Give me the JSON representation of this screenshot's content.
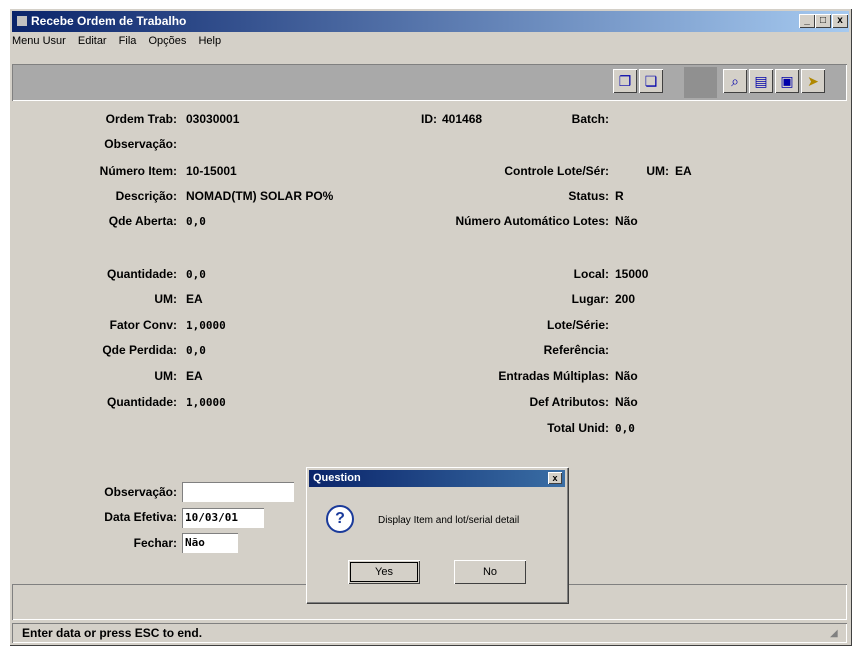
{
  "window": {
    "title": "Recebe Ordem de Trabalho"
  },
  "titlebar_buttons": {
    "minimize": "_",
    "maximize": "□",
    "close": "x"
  },
  "menu": [
    "Menu Usur",
    "Editar",
    "Fila",
    "Opções",
    "Help"
  ],
  "toolbar": {
    "icons": [
      "copy-icon",
      "paste-icon",
      "find-icon",
      "next-icon",
      "export-icon",
      "exit-icon"
    ]
  },
  "form": {
    "ordem_trab_label": "Ordem Trab:",
    "ordem_trab_value": "03030001",
    "id_label": "ID:",
    "id_value": "401468",
    "batch_label": "Batch:",
    "observacao_label": "Observação:",
    "numero_item_label": "Número Item:",
    "numero_item_value": "10-15001",
    "controle_lote_label": "Controle Lote/Sér:",
    "um_top_label": "UM:",
    "um_top_value": "EA",
    "descricao_label": "Descrição:",
    "descricao_value": "NOMAD(TM) SOLAR PO%",
    "status_label": "Status:",
    "status_value": "R",
    "qde_aberta_label": "Qde Aberta:",
    "qde_aberta_value": "0,0",
    "num_auto_lotes_label": "Número Automático Lotes:",
    "num_auto_lotes_value": "Não",
    "quantidade_label": "Quantidade:",
    "quantidade_value": "0,0",
    "local_label": "Local:",
    "local_value": "15000",
    "um1_label": "UM:",
    "um1_value": "EA",
    "lugar_label": "Lugar:",
    "lugar_value": "200",
    "fator_conv_label": "Fator Conv:",
    "fator_conv_value": "1,0000",
    "lote_serie_label": "Lote/Série:",
    "qde_perdida_label": "Qde Perdida:",
    "qde_perdida_value": "0,0",
    "referencia_label": "Referência:",
    "um2_label": "UM:",
    "um2_value": "EA",
    "entradas_label": "Entradas Múltiplas:",
    "entradas_value": "Não",
    "quantidade2_label": "Quantidade:",
    "quantidade2_value": "1,0000",
    "def_atributos_label": "Def Atributos:",
    "def_atributos_value": "Não",
    "total_unid_label": "Total Unid:",
    "total_unid_value": "0,0",
    "obs_input_label": "Observação:",
    "obs_input_value": "",
    "data_efetiva_label": "Data Efetiva:",
    "data_efetiva_value": "10/03/01",
    "fechar_label": "Fechar:",
    "fechar_value": "Não"
  },
  "dialog": {
    "title": "Question",
    "icon": "question-icon",
    "message": "Display Item and lot/serial detail",
    "yes_label": "Yes",
    "no_label": "No"
  },
  "status": {
    "text": "Enter data or press ESC to end."
  }
}
